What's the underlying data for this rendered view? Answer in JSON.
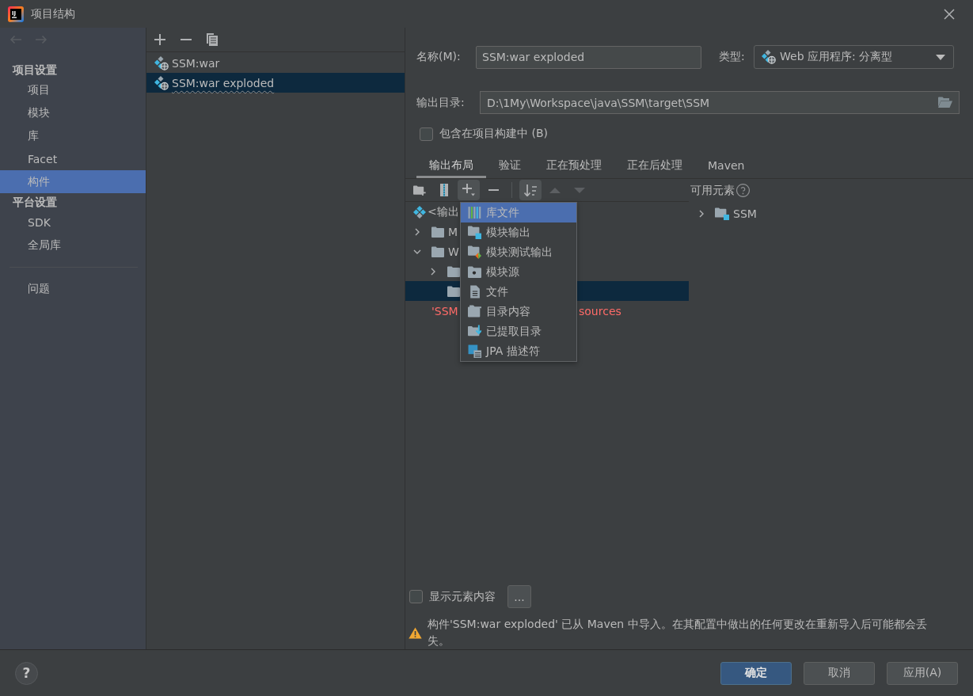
{
  "window": {
    "title": "项目结构",
    "logo_text": "IJ"
  },
  "nav": [
    {
      "kind": "back",
      "disabled": true
    },
    {
      "kind": "forward",
      "disabled": true
    }
  ],
  "sidebar": {
    "sections": [
      {
        "header": "项目设置",
        "items": [
          {
            "label": "项目",
            "selected": false
          },
          {
            "label": "模块",
            "selected": false
          },
          {
            "label": "库",
            "selected": false
          },
          {
            "label": "Facet",
            "selected": false
          },
          {
            "label": "构件",
            "selected": true
          }
        ]
      },
      {
        "header": "平台设置",
        "items": [
          {
            "label": "SDK",
            "selected": false
          },
          {
            "label": "全局库",
            "selected": false
          }
        ]
      }
    ],
    "bottom_items": [
      {
        "label": "问题",
        "selected": false
      }
    ]
  },
  "artifacts": [
    {
      "name": "SSM:war",
      "selected": false,
      "spell_warning": false
    },
    {
      "name": "SSM:war exploded",
      "selected": true,
      "spell_warning": true
    }
  ],
  "details": {
    "name_label": "名称(M):",
    "name_value": "SSM:war exploded",
    "type_label": "类型:",
    "type_value": "Web 应用程序: 分离型",
    "output_label": "输出目录:",
    "output_value": "D:\\1My\\Workspace\\java\\SSM\\target\\SSM",
    "include_in_build": {
      "label": "包含在项目构建中 (B)",
      "checked": false
    }
  },
  "tabs": [
    {
      "label": "输出布局",
      "selected": true
    },
    {
      "label": "验证",
      "selected": false
    },
    {
      "label": "正在预处理",
      "selected": false
    },
    {
      "label": "正在后处理",
      "selected": false
    },
    {
      "label": "Maven",
      "selected": false
    }
  ],
  "layout_toolbar": [
    {
      "kind": "new-folder",
      "pressed": false,
      "disabled": false
    },
    {
      "kind": "archive",
      "pressed": false,
      "disabled": false
    },
    {
      "kind": "add",
      "pressed": true,
      "disabled": false
    },
    {
      "kind": "remove",
      "pressed": false,
      "disabled": false
    },
    {
      "kind": "separator"
    },
    {
      "kind": "sort",
      "pressed": true,
      "disabled": false
    },
    {
      "kind": "up",
      "pressed": false,
      "disabled": true
    },
    {
      "kind": "down",
      "pressed": false,
      "disabled": true
    }
  ],
  "output_tree": [
    {
      "kind": "root",
      "label": "<输出",
      "selected": false,
      "children": [
        {
          "kind": "folder",
          "label": "M",
          "expanded": false,
          "selected": false
        },
        {
          "kind": "folder",
          "label": "W",
          "expanded": true,
          "selected": false,
          "children": [
            {
              "kind": "folder",
              "expanded": false,
              "selected": false
            },
            {
              "kind": "folder",
              "selected": true
            }
          ]
        }
      ]
    }
  ],
  "problem_message": [
    "'SSM",
    "sources"
  ],
  "add_menu": [
    {
      "kind": "library",
      "label": "库文件",
      "selected": true
    },
    {
      "kind": "module-output",
      "label": "模块输出",
      "selected": false
    },
    {
      "kind": "test-output",
      "label": "模块测试输出",
      "selected": false
    },
    {
      "kind": "module-source",
      "label": "模块源",
      "selected": false
    },
    {
      "kind": "file",
      "label": "文件",
      "selected": false
    },
    {
      "kind": "directory-content",
      "label": "目录内容",
      "selected": false
    },
    {
      "kind": "extracted",
      "label": "已提取目录",
      "selected": false
    },
    {
      "kind": "jpa",
      "label": "JPA 描述符",
      "selected": false
    }
  ],
  "available_elements": {
    "title": "可用元素",
    "items": [
      {
        "label": "SSM",
        "expanded": false,
        "selected": false
      }
    ]
  },
  "show_content": {
    "label": "显示元素内容",
    "checked": false
  },
  "more_button": "...",
  "warning": "构件'SSM:war exploded' 已从 Maven 中导入。在其配置中做出的任何更改在重新导入后可能都会丢失。",
  "footer": {
    "help_label": "?",
    "buttons": [
      {
        "label": "确定",
        "default": true
      },
      {
        "label": "取消",
        "default": false
      },
      {
        "label": "应用(A)",
        "default": false
      }
    ]
  }
}
